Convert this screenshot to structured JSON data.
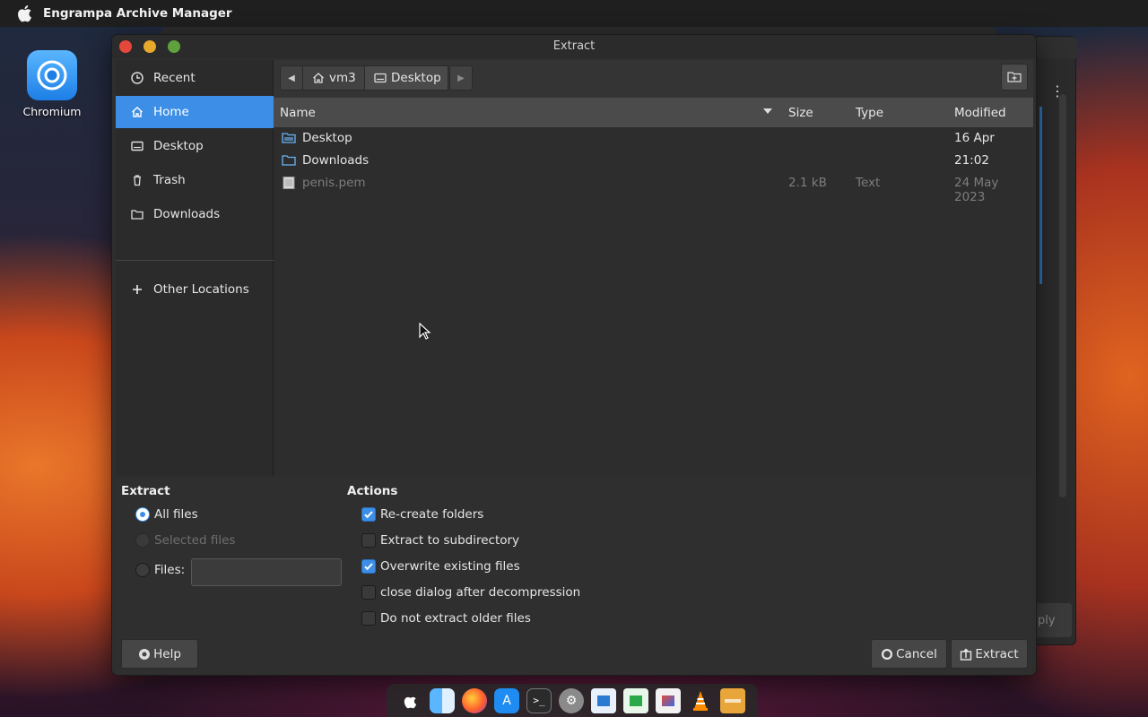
{
  "menubar": {
    "app_name": "Engrampa Archive Manager"
  },
  "desktop": {
    "icon_label": "Chromium"
  },
  "dialog": {
    "title": "Extract",
    "sidebar": {
      "items": [
        {
          "label": "Recent",
          "icon": "clock-icon"
        },
        {
          "label": "Home",
          "icon": "home-icon",
          "active": true
        },
        {
          "label": "Desktop",
          "icon": "desktop-icon"
        },
        {
          "label": "Trash",
          "icon": "trash-icon"
        },
        {
          "label": "Downloads",
          "icon": "folder-icon"
        }
      ],
      "other_locations": "Other Locations"
    },
    "pathbar": {
      "segments": [
        {
          "label": "vm3",
          "icon": "home-icon"
        },
        {
          "label": "Desktop",
          "icon": "desktop-icon"
        }
      ]
    },
    "columns": {
      "name": "Name",
      "size": "Size",
      "type": "Type",
      "modified": "Modified"
    },
    "files": [
      {
        "name": "Desktop",
        "size": "",
        "type": "",
        "modified": "16 Apr",
        "kind": "folder"
      },
      {
        "name": "Downloads",
        "size": "",
        "type": "",
        "modified": "21:02",
        "kind": "folder"
      },
      {
        "name": "penis.pem",
        "size": "2.1 kB",
        "type": "Text",
        "modified": "24 May 2023",
        "kind": "file"
      }
    ],
    "extract": {
      "title": "Extract",
      "all_files": "All files",
      "selected_files": "Selected files",
      "files_label": "Files:",
      "files_value": ""
    },
    "actions": {
      "title": "Actions",
      "recreate_folders": "Re-create folders",
      "extract_subdir": "Extract to subdirectory",
      "overwrite": "Overwrite existing files",
      "close_dialog": "close dialog after decompression",
      "no_older": "Do not extract older files"
    },
    "buttons": {
      "help": "Help",
      "cancel": "Cancel",
      "extract": "Extract"
    }
  },
  "background_window": {
    "apply_partial": "ply"
  },
  "colors": {
    "accent": "#3d8ee6",
    "close": "#e5473b",
    "minimize": "#e7a92b",
    "maximize": "#5fa23d"
  }
}
